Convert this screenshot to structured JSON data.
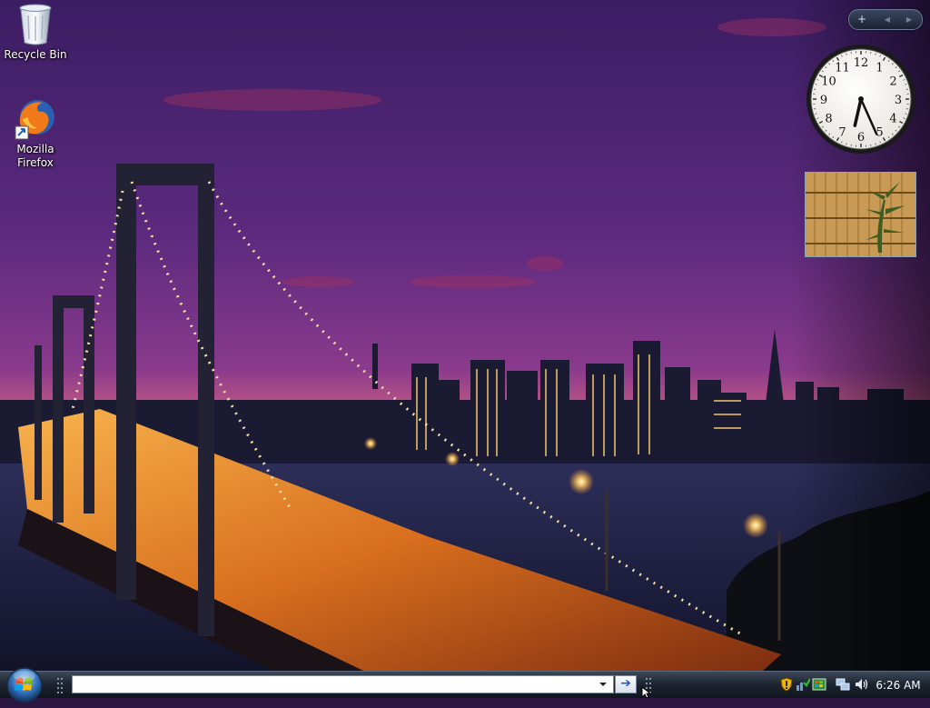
{
  "desktop": {
    "icons": [
      {
        "label": "Recycle Bin",
        "icon": "recycle-bin-icon"
      },
      {
        "label": "Mozilla Firefox",
        "icon": "firefox-icon"
      }
    ]
  },
  "sidebar": {
    "controls": {
      "add": "+",
      "previous": "◀",
      "next": "▶"
    },
    "clock": {
      "hour_numerals": [
        "12",
        "1",
        "2",
        "3",
        "4",
        "5",
        "6",
        "7",
        "8",
        "9",
        "10",
        "11"
      ],
      "time": "6:26"
    },
    "slideshow": {
      "image": "bamboo-plant"
    }
  },
  "taskbar": {
    "start_icon": "windows-orb-icon",
    "address_toolbar": {
      "value": "",
      "dropdown_icon": "chevron-down-icon",
      "go_icon": "arrow-right-icon",
      "go_label": "➔"
    },
    "tray": {
      "icons": [
        "security-shield-icon",
        "network-status-icon",
        "windows-update-icon",
        "network-icon",
        "volume-icon"
      ],
      "time": "6:26 AM"
    }
  },
  "colors": {
    "taskbar": "#1e2632",
    "accent": "#f0a53a",
    "sky": "#5a2a7a"
  }
}
